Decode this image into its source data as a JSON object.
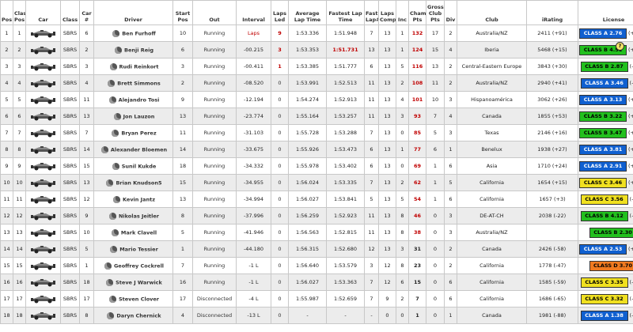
{
  "headers": [
    "Pos",
    "Class Pos",
    "Car",
    "Class",
    "Car #",
    "Driver",
    "Start Pos",
    "Out",
    "Interval",
    "Laps Led",
    "Average Lap Time",
    "Fastest Lap Time",
    "Fast Lap#",
    "Laps Comp",
    "Inc",
    "Champ Pts",
    "Gross Club Pts",
    "Div",
    "Club",
    "iRating",
    "License"
  ],
  "colors": {
    "class_a": "#1060d0",
    "class_b": "#22c01e",
    "class_c": "#f0e020",
    "class_d": "#f07a20",
    "red_text": "#c00000"
  },
  "icons": {
    "car": "race-car-icon",
    "helmet": "helmet-icon",
    "help": "question-mark-icon"
  },
  "rows": [
    {
      "pos": "1",
      "cpos": "1",
      "cls": "SBRS",
      "car": "6",
      "driver": "Ben Furhoff",
      "start": "10",
      "out": "Running",
      "interval": "Laps",
      "led": "9",
      "avg": "1:53.336",
      "fast": "1:51.948",
      "flap": "7",
      "comp": "13",
      "inc": "1",
      "champ": "132",
      "gross": "17",
      "div": "2",
      "club": "Australia/NZ",
      "irating": "2411 (+91)",
      "license": "CLASS A 2.76",
      "delta": "(+0.14)",
      "lclass": "A"
    },
    {
      "pos": "2",
      "cpos": "2",
      "cls": "SBRS",
      "car": "2",
      "driver": "Benji Reig",
      "start": "6",
      "out": "Running",
      "interval": "-00.215",
      "led": "3",
      "avg": "1:53.353",
      "fast": "1:51.731",
      "flap": "13",
      "comp": "13",
      "inc": "1",
      "champ": "124",
      "gross": "15",
      "div": "4",
      "club": "Iberia",
      "irating": "5468 (+15)",
      "license": "CLASS B 4.51",
      "delta": "(+0.54)",
      "lclass": "B",
      "help": "?"
    },
    {
      "pos": "3",
      "cpos": "3",
      "cls": "SBRS",
      "car": "3",
      "driver": "Rudi Reinkort",
      "start": "3",
      "out": "Running",
      "interval": "-00.411",
      "led": "1",
      "avg": "1:53.385",
      "fast": "1:51.777",
      "flap": "6",
      "comp": "13",
      "inc": "5",
      "champ": "116",
      "gross": "13",
      "div": "2",
      "club": "Central-Eastern Europe",
      "irating": "3843 (+30)",
      "license": "CLASS B 2.87",
      "delta": "(-0.01)",
      "lclass": "B"
    },
    {
      "pos": "4",
      "cpos": "4",
      "cls": "SBRS",
      "car": "4",
      "driver": "Brett Simmons",
      "start": "2",
      "out": "Running",
      "interval": "-08.520",
      "led": "0",
      "avg": "1:53.991",
      "fast": "1:52.513",
      "flap": "11",
      "comp": "13",
      "inc": "2",
      "champ": "108",
      "gross": "11",
      "div": "2",
      "club": "Australia/NZ",
      "irating": "2940 (+41)",
      "license": "CLASS A 3.46",
      "delta": "(-0.02)",
      "lclass": "A"
    },
    {
      "pos": "5",
      "cpos": "5",
      "cls": "SBRS",
      "car": "11",
      "driver": "Alejandro Tosi",
      "start": "9",
      "out": "Running",
      "interval": "-12.194",
      "led": "0",
      "avg": "1:54.274",
      "fast": "1:52.913",
      "flap": "11",
      "comp": "13",
      "inc": "4",
      "champ": "101",
      "gross": "10",
      "div": "3",
      "club": "Hispanoamérica",
      "irating": "3062 (+26)",
      "license": "CLASS A 3.13",
      "delta": "(+0.09)",
      "lclass": "A"
    },
    {
      "pos": "6",
      "cpos": "6",
      "cls": "SBRS",
      "car": "13",
      "driver": "Jon Lauzon",
      "start": "13",
      "out": "Running",
      "interval": "-23.774",
      "led": "0",
      "avg": "1:55.164",
      "fast": "1:53.257",
      "flap": "11",
      "comp": "13",
      "inc": "3",
      "champ": "93",
      "gross": "7",
      "div": "4",
      "club": "Canada",
      "irating": "1855 (+53)",
      "license": "CLASS B 3.22",
      "delta": "(+0.03)",
      "lclass": "B"
    },
    {
      "pos": "7",
      "cpos": "7",
      "cls": "SBRS",
      "car": "7",
      "driver": "Bryan Perez",
      "start": "11",
      "out": "Running",
      "interval": "-31.103",
      "led": "0",
      "avg": "1:55.728",
      "fast": "1:53.288",
      "flap": "7",
      "comp": "13",
      "inc": "0",
      "champ": "85",
      "gross": "5",
      "div": "3",
      "club": "Texas",
      "irating": "2146 (+16)",
      "license": "CLASS B 3.47",
      "delta": "(+0.05)",
      "lclass": "B"
    },
    {
      "pos": "8",
      "cpos": "8",
      "cls": "SBRS",
      "car": "14",
      "driver": "Alexander Bloemen",
      "start": "14",
      "out": "Running",
      "interval": "-33.675",
      "led": "0",
      "avg": "1:55.926",
      "fast": "1:53.473",
      "flap": "6",
      "comp": "13",
      "inc": "1",
      "champ": "77",
      "gross": "6",
      "div": "1",
      "club": "Benelux",
      "irating": "1938 (+27)",
      "license": "CLASS A 3.81",
      "delta": "(+0.14)",
      "lclass": "A"
    },
    {
      "pos": "9",
      "cpos": "9",
      "cls": "SBRS",
      "car": "15",
      "driver": "Sunil Kukde",
      "start": "18",
      "out": "Running",
      "interval": "-34.332",
      "led": "0",
      "avg": "1:55.978",
      "fast": "1:53.402",
      "flap": "6",
      "comp": "13",
      "inc": "0",
      "champ": "69",
      "gross": "1",
      "div": "6",
      "club": "Asia",
      "irating": "1710 (+24)",
      "license": "CLASS A 2.91",
      "delta": "(+0.03)",
      "lclass": "A"
    },
    {
      "pos": "10",
      "cpos": "10",
      "cls": "SBRS",
      "car": "13",
      "driver": "Brian Knudson5",
      "start": "15",
      "out": "Running",
      "interval": "-34.955",
      "led": "0",
      "avg": "1:56.024",
      "fast": "1:53.335",
      "flap": "7",
      "comp": "13",
      "inc": "2",
      "champ": "62",
      "gross": "1",
      "div": "5",
      "club": "California",
      "irating": "1654 (+15)",
      "license": "CLASS C 3.46",
      "delta": "(+0.03)",
      "lclass": "C"
    },
    {
      "pos": "11",
      "cpos": "11",
      "cls": "SBRS",
      "car": "12",
      "driver": "Kevin Jantz",
      "start": "13",
      "out": "Running",
      "interval": "-34.994",
      "led": "0",
      "avg": "1:56.027",
      "fast": "1:53.841",
      "flap": "5",
      "comp": "13",
      "inc": "5",
      "champ": "54",
      "gross": "1",
      "div": "6",
      "club": "California",
      "irating": "1657 (+3)",
      "license": "CLASS C 3.56",
      "delta": "(-0.06)",
      "lclass": "C"
    },
    {
      "pos": "12",
      "cpos": "12",
      "cls": "SBRS",
      "car": "9",
      "driver": "Nikolas Jeitler",
      "start": "8",
      "out": "Running",
      "interval": "-37.996",
      "led": "0",
      "avg": "1:56.259",
      "fast": "1:52.923",
      "flap": "11",
      "comp": "13",
      "inc": "8",
      "champ": "46",
      "gross": "0",
      "div": "3",
      "club": "DE-AT-CH",
      "irating": "2038 (-22)",
      "license": "CLASS B 4.12",
      "delta": "(-0.11)",
      "lclass": "B"
    },
    {
      "pos": "13",
      "cpos": "13",
      "cls": "SBRS",
      "car": "10",
      "driver": "Mark Clavell",
      "start": "5",
      "out": "Running",
      "interval": "-41.946",
      "led": "0",
      "avg": "1:56.563",
      "fast": "1:52.815",
      "flap": "11",
      "comp": "13",
      "inc": "8",
      "champ": "38",
      "gross": "0",
      "div": "3",
      "club": "Australia/NZ",
      "irating": "",
      "license": "CLASS B 2.30",
      "delta": "",
      "lclass": "B"
    },
    {
      "pos": "14",
      "cpos": "14",
      "cls": "SBRS",
      "car": "5",
      "driver": "Mario Tessier",
      "start": "1",
      "out": "Running",
      "interval": "-44.180",
      "led": "0",
      "avg": "1:56.315",
      "fast": "1:52.680",
      "flap": "12",
      "comp": "13",
      "inc": "3",
      "champ": "31",
      "gross": "0",
      "div": "2",
      "club": "Canada",
      "irating": "2426 (-58)",
      "license": "CLASS A 2.53",
      "delta": "(+0.03)",
      "lclass": "A"
    },
    {
      "pos": "15",
      "cpos": "15",
      "cls": "SBRS",
      "car": "1",
      "driver": "Geoffrey Cockrell",
      "start": "7",
      "out": "Running",
      "interval": "-1 L",
      "led": "0",
      "avg": "1:56.640",
      "fast": "1:53.579",
      "flap": "3",
      "comp": "12",
      "inc": "8",
      "champ": "23",
      "gross": "0",
      "div": "2",
      "club": "California",
      "irating": "1778 (-47)",
      "license": "CLASS D 3.70",
      "delta": "",
      "lclass": "D"
    },
    {
      "pos": "16",
      "cpos": "16",
      "cls": "SBRS",
      "car": "18",
      "driver": "Steve J Warwick",
      "start": "16",
      "out": "Running",
      "interval": "-1 L",
      "led": "0",
      "avg": "1:56.027",
      "fast": "1:53.363",
      "flap": "7",
      "comp": "12",
      "inc": "6",
      "champ": "15",
      "gross": "0",
      "div": "6",
      "club": "California",
      "irating": "1585 (-59)",
      "license": "CLASS C 3.35",
      "delta": "(-0.07)",
      "lclass": "C"
    },
    {
      "pos": "17",
      "cpos": "17",
      "cls": "SBRS",
      "car": "17",
      "driver": "Steven Clover",
      "start": "17",
      "out": "Disconnected",
      "interval": "-4 L",
      "led": "0",
      "avg": "1:55.987",
      "fast": "1:52.659",
      "flap": "7",
      "comp": "9",
      "inc": "2",
      "champ": "7",
      "gross": "0",
      "div": "6",
      "club": "California",
      "irating": "1686 (-65)",
      "license": "CLASS C 3.32",
      "delta": "(-0.04)",
      "lclass": "C"
    },
    {
      "pos": "18",
      "cpos": "18",
      "cls": "SBRS",
      "car": "8",
      "driver": "Daryn Chernick",
      "start": "4",
      "out": "Disconnected",
      "interval": "-13 L",
      "led": "0",
      "avg": "-",
      "fast": "-",
      "flap": "-",
      "comp": "0",
      "inc": "0",
      "champ": "1",
      "gross": "0",
      "div": "1",
      "club": "Canada",
      "irating": "1981 (-88)",
      "license": "CLASS A 1.38",
      "delta": "(-0.05)",
      "lclass": "A"
    }
  ]
}
